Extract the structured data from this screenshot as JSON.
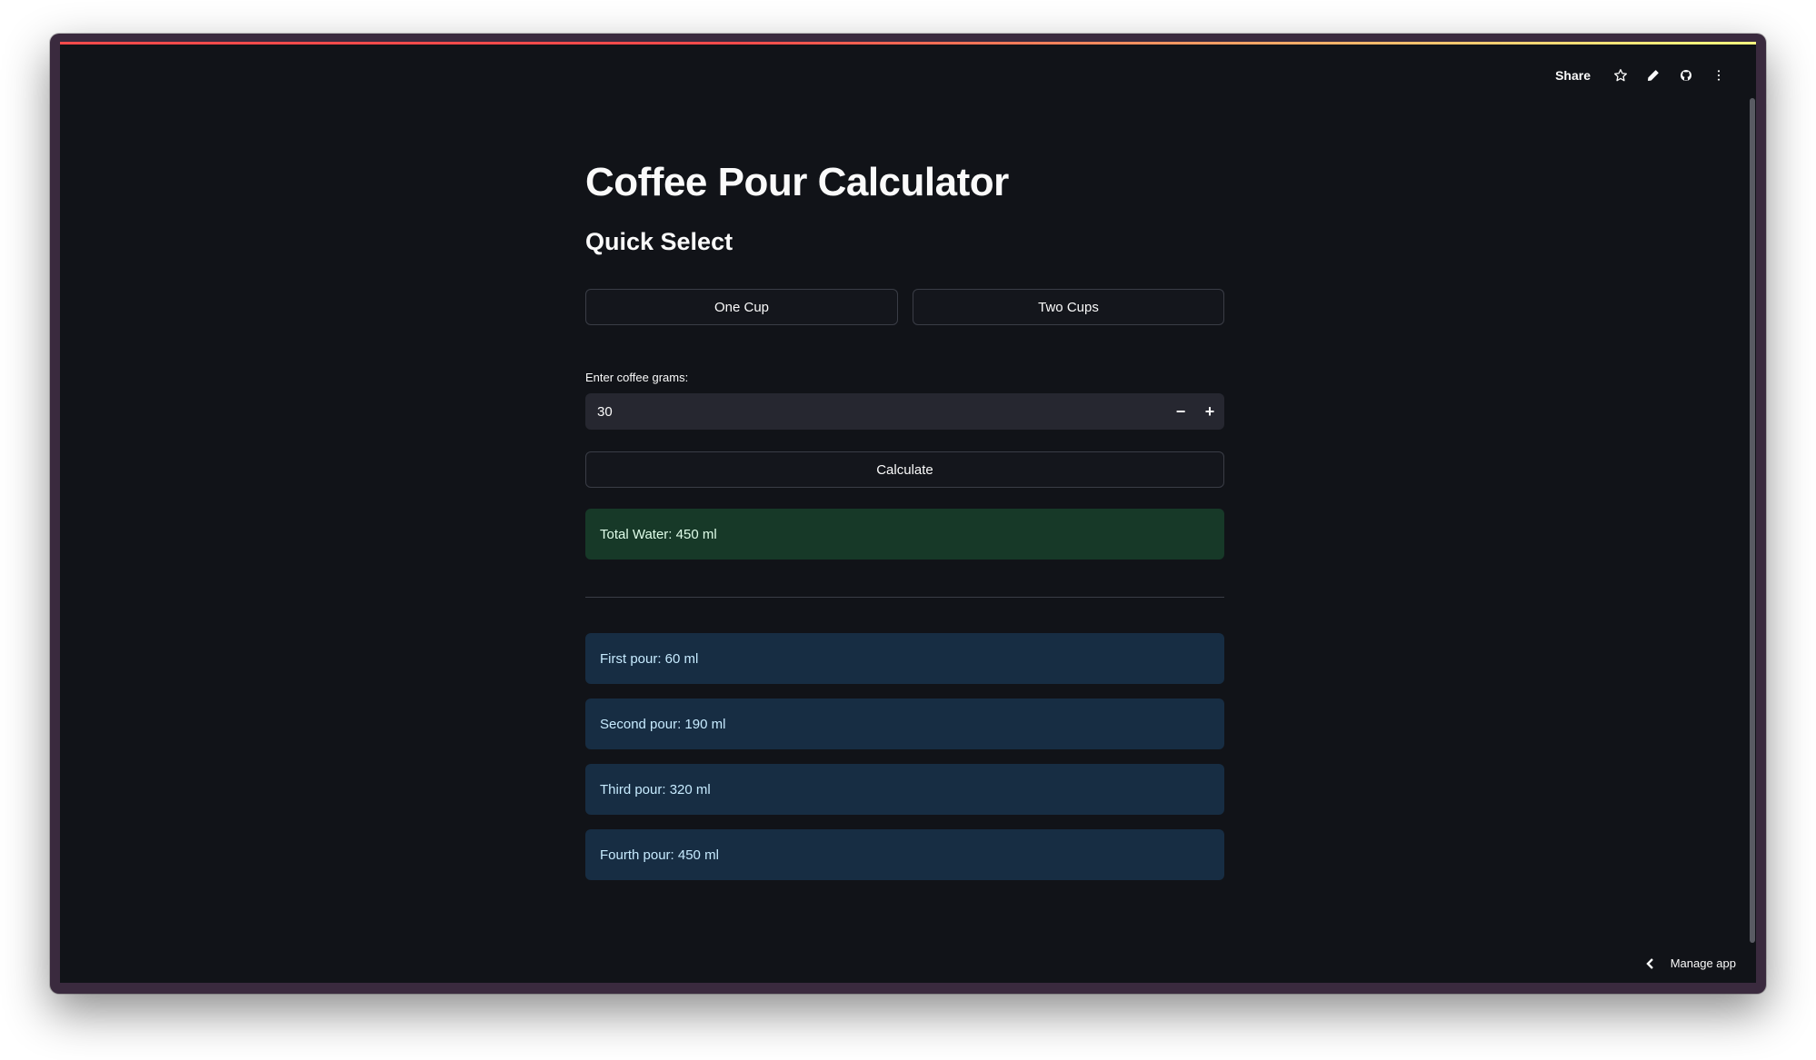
{
  "header": {
    "share_label": "Share",
    "icons": [
      "star-icon",
      "pencil-icon",
      "github-icon",
      "more-vertical-icon"
    ]
  },
  "main": {
    "title": "Coffee Pour Calculator",
    "quick_select_heading": "Quick Select",
    "one_cup_label": "One Cup",
    "two_cups_label": "Two Cups",
    "coffee_grams_label": "Enter coffee grams:",
    "coffee_grams_value": "30",
    "decrement_label": "−",
    "increment_label": "+",
    "calculate_label": "Calculate",
    "total_water": "Total Water: 450 ml",
    "pours": [
      "First pour: 60 ml",
      "Second pour: 190 ml",
      "Third pour: 320 ml",
      "Fourth pour: 450 ml"
    ]
  },
  "footer": {
    "manage_app_label": "Manage app"
  },
  "colors": {
    "background": "#111318",
    "success_bg": "#173928",
    "info_bg": "#172d43",
    "accent": "#ff4b4b"
  }
}
